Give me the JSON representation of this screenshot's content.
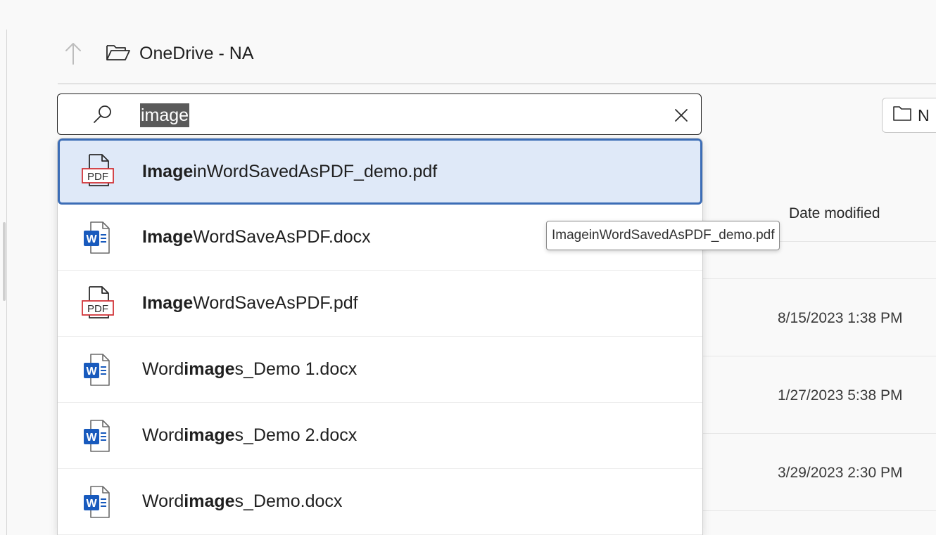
{
  "breadcrumb": {
    "location": "OneDrive - NA"
  },
  "search": {
    "value": "image",
    "suggestions": [
      {
        "type": "pdf",
        "match": "Image",
        "rest": "inWordSavedAsPDF_demo.pdf",
        "selected": true
      },
      {
        "type": "word",
        "match": "Image",
        "rest": "WordSaveAsPDF.docx"
      },
      {
        "type": "pdf",
        "match": "Image",
        "rest": "WordSaveAsPDF.pdf"
      },
      {
        "type": "word",
        "pre": "Word",
        "match": "image",
        "rest": "s_Demo 1.docx"
      },
      {
        "type": "word",
        "pre": "Word",
        "match": "image",
        "rest": "s_Demo 2.docx"
      },
      {
        "type": "word",
        "pre": "Word",
        "match": "image",
        "rest": "s_Demo.docx"
      }
    ]
  },
  "tooltip": {
    "text": "ImageinWordSavedAsPDF_demo.pdf"
  },
  "toolbar": {
    "new_folder_label": "N"
  },
  "columns": {
    "date_modified": "Date modified"
  },
  "files": [
    {
      "date": "8/15/2023 1:38 PM"
    },
    {
      "date": "1/27/2023 5:38 PM"
    },
    {
      "date": "3/29/2023 2:30 PM"
    }
  ],
  "icons": {
    "pdf_label": "PDF",
    "word_label": "W",
    "pdf_color": "#d13438",
    "word_color": "#185abd"
  }
}
